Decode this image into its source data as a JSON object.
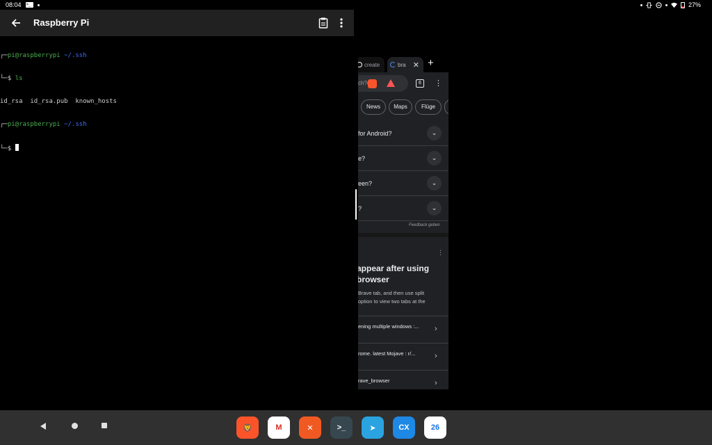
{
  "status_bar": {
    "time": "08:04",
    "battery_text": "27%"
  },
  "terminal_app": {
    "title": "Raspberry Pi",
    "lines": [
      {
        "user": "pi@raspberrypi",
        "path": "~/.ssh"
      },
      {
        "prompt": "└─$",
        "cmd": "ls"
      },
      {
        "output": "id_rsa  id_rsa.pub  known_hosts"
      },
      {
        "user": "pi@raspberrypi",
        "path": "~/.ssh"
      },
      {
        "prompt": "└─$"
      }
    ]
  },
  "browser": {
    "tabs": [
      {
        "label": "create"
      },
      {
        "label": "bra"
      }
    ],
    "url_text": "ch?c",
    "tab_count": "6",
    "chips": [
      "News",
      "Maps",
      "Flüge"
    ],
    "faq_items": [
      {
        "q": "for Android?"
      },
      {
        "q": "e?"
      },
      {
        "q": "een?"
      },
      {
        "q": "?"
      }
    ],
    "feedback": "Feedback geben",
    "card_title": "appear after using browser",
    "card_body_lines": [
      "Brave tab, and then use split",
      "option to view two tabs at the"
    ],
    "links": [
      {
        "text": "ening multiple windows :..."
      },
      {
        "text": "rome. latest Mojave : r/..."
      },
      {
        "text": "rave_browser"
      }
    ]
  },
  "taskbar": {
    "apps": [
      {
        "name": "brave-app-icon",
        "color": "#fb542b",
        "glyph": "🦁"
      },
      {
        "name": "gmail-app-icon",
        "color": "#ffffff",
        "glyph": "M"
      },
      {
        "name": "xodo-app-icon",
        "color": "#f05a22",
        "glyph": "✕"
      },
      {
        "name": "terminal-app-icon",
        "color": "#37474f",
        "glyph": ">_"
      },
      {
        "name": "telegram-app-icon",
        "color": "#2aa3e0",
        "glyph": "➤"
      },
      {
        "name": "cx-files-app-icon",
        "color": "#1e88e5",
        "glyph": "CX"
      },
      {
        "name": "calendar-app-icon",
        "color": "#ffffff",
        "glyph": "26"
      }
    ]
  }
}
